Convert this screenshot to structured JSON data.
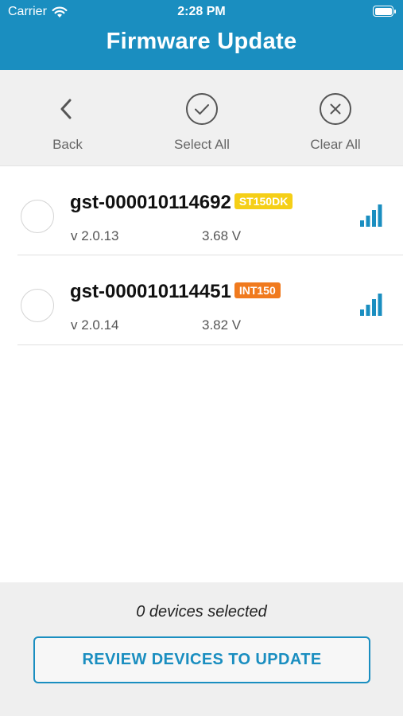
{
  "status_bar": {
    "carrier": "Carrier",
    "time": "2:28 PM",
    "wifi_icon": "wifi-icon",
    "battery_icon": "battery-icon"
  },
  "header": {
    "title": "Firmware Update",
    "background_color": "#1a8ec0"
  },
  "toolbar": {
    "back": {
      "label": "Back",
      "icon": "chevron-left-icon"
    },
    "select_all": {
      "label": "Select All",
      "icon": "check-circle-icon"
    },
    "clear_all": {
      "label": "Clear All",
      "icon": "x-circle-icon"
    }
  },
  "devices": [
    {
      "name": "gst-000010114692",
      "tag": "ST150DK",
      "tag_color": "#f5cf17",
      "version": "v 2.0.13",
      "voltage": "3.68 V",
      "selected": false,
      "signal_icon": "signal-strength-icon",
      "signal_bars": 4
    },
    {
      "name": "gst-000010114451",
      "tag": "INT150",
      "tag_color": "#f07a1e",
      "version": "v 2.0.14",
      "voltage": "3.82 V",
      "selected": false,
      "signal_icon": "signal-strength-icon",
      "signal_bars": 4
    }
  ],
  "footer": {
    "selected_count_text": "0 devices selected",
    "review_button_label": "REVIEW DEVICES TO UPDATE",
    "accent_color": "#1a8ec0"
  }
}
